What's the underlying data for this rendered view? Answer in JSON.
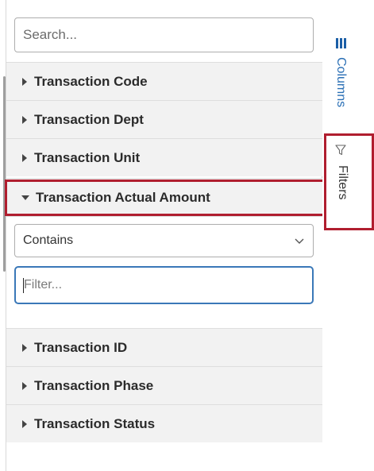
{
  "search": {
    "placeholder": "Search..."
  },
  "groups_top": [
    {
      "label": "Transaction Code"
    },
    {
      "label": "Transaction Dept"
    },
    {
      "label": "Transaction Unit"
    }
  ],
  "expanded_group": {
    "label": "Transaction Actual Amount",
    "operator": "Contains",
    "filter_placeholder": "Filter..."
  },
  "groups_bottom": [
    {
      "label": "Transaction ID"
    },
    {
      "label": "Transaction Phase"
    },
    {
      "label": "Transaction Status"
    }
  ],
  "side_tabs": {
    "columns": "Columns",
    "filters": "Filters"
  },
  "colors": {
    "highlight": "#b01e2f",
    "accent": "#2a6fb5",
    "focus_border": "#3a78b8"
  },
  "icons": {
    "columns": "columns-icon",
    "filters": "funnel-icon",
    "collapsed": "caret-right-icon",
    "expanded": "caret-down-icon",
    "dropdown": "chevron-down-icon"
  }
}
